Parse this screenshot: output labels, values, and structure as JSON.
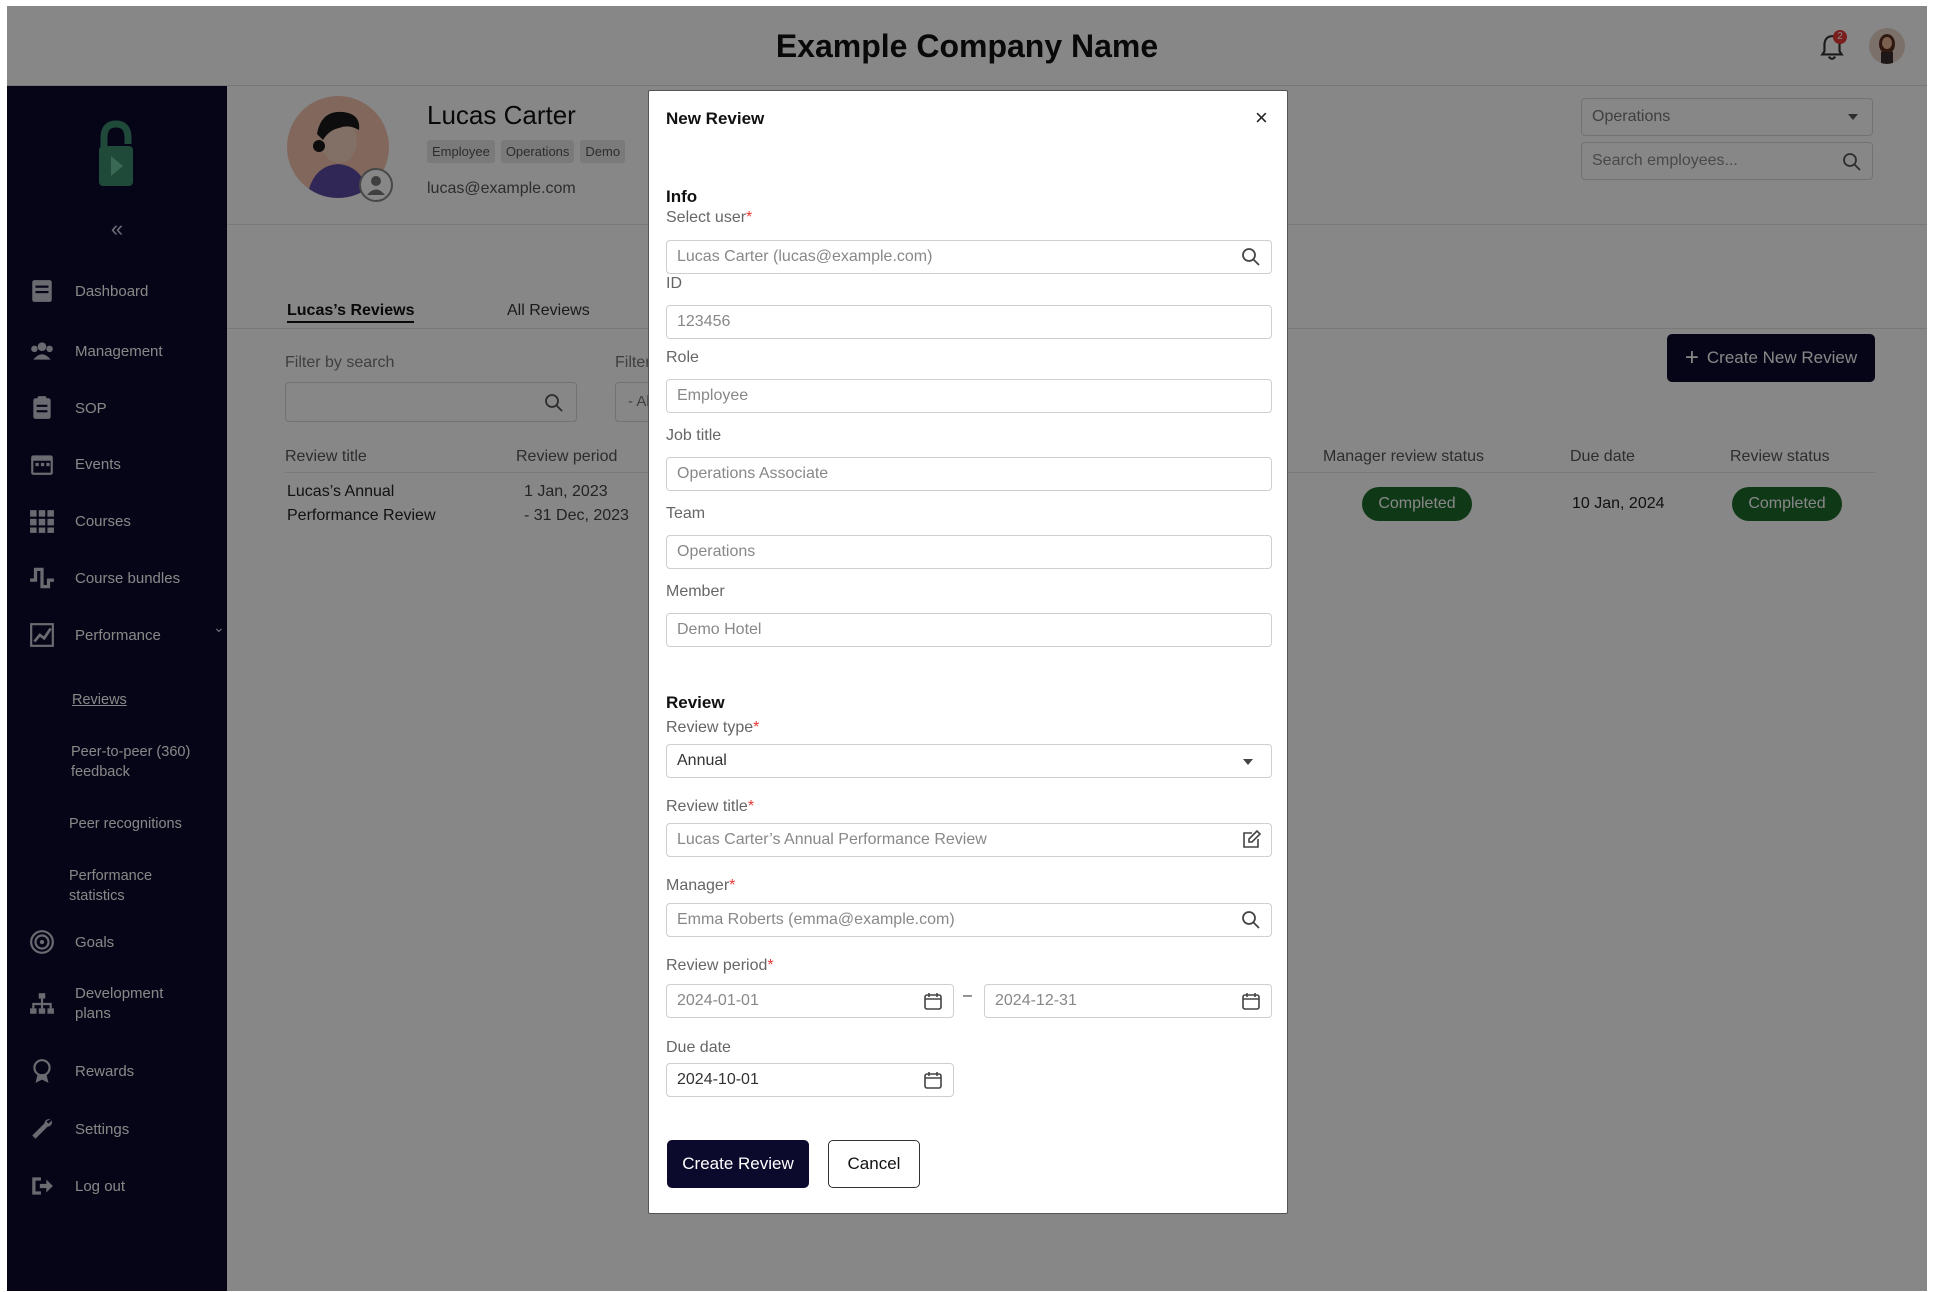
{
  "header": {
    "company_name": "Example Company Name",
    "notification_count": "2"
  },
  "sidebar": {
    "collapse_label": "«",
    "items": [
      {
        "label": "Dashboard",
        "icon": "dashboard-icon"
      },
      {
        "label": "Management",
        "icon": "people-icon"
      },
      {
        "label": "SOP",
        "icon": "clipboard-icon"
      },
      {
        "label": "Events",
        "icon": "calendar-icon"
      },
      {
        "label": "Courses",
        "icon": "grid-icon"
      },
      {
        "label": "Course bundles",
        "icon": "bundle-icon"
      },
      {
        "label": "Performance",
        "icon": "chart-icon"
      },
      {
        "label": "Goals",
        "icon": "target-icon"
      },
      {
        "label": "Development plans",
        "icon": "org-chart-icon"
      },
      {
        "label": "Rewards",
        "icon": "ribbon-icon"
      },
      {
        "label": "Settings",
        "icon": "wrench-icon"
      },
      {
        "label": "Log out",
        "icon": "logout-icon"
      }
    ],
    "performance_sub": [
      "Reviews",
      "Peer-to-peer (360) feedback",
      "Peer recognitions",
      "Performance statistics"
    ]
  },
  "profile": {
    "name": "Lucas Carter",
    "tags": [
      "Employee",
      "Operations",
      "Demo"
    ],
    "email": "lucas@example.com"
  },
  "controls": {
    "team_select": "Operations",
    "search_placeholder": "Search employees..."
  },
  "tabs": [
    "Lucas’s Reviews",
    "All Reviews"
  ],
  "create_button": "Create New Review",
  "filters": {
    "search_label": "Filter by search",
    "second_label": "Filter",
    "second_value": "- Al"
  },
  "table": {
    "headers": [
      "Review title",
      "Review period",
      "Manager review status",
      "Due date",
      "Review status"
    ],
    "rows": [
      {
        "title_line1": "Lucas’s Annual",
        "title_line2": "Performance Review",
        "period_line1": "1 Jan, 2023",
        "period_line2": "- 31 Dec, 2023",
        "manager_status": "Completed",
        "due_date": "10 Jan, 2024",
        "review_status": "Completed"
      }
    ]
  },
  "modal": {
    "title": "New Review",
    "close": "×",
    "info_section": "Info",
    "fields": {
      "select_user_label": "Select user",
      "select_user_value": "Lucas Carter (lucas@example.com)",
      "id_label": "ID",
      "id_value": "123456",
      "role_label": "Role",
      "role_value": "Employee",
      "job_title_label": "Job title",
      "job_title_value": "Operations Associate",
      "team_label": "Team",
      "team_value": "Operations",
      "member_label": "Member",
      "member_value": "Demo Hotel"
    },
    "review_section": "Review",
    "review": {
      "type_label": "Review type",
      "type_value": "Annual",
      "title_label": "Review title",
      "title_value": "Lucas Carter’s Annual Performance Review",
      "manager_label": "Manager",
      "manager_value": "Emma Roberts (emma@example.com)",
      "period_label": "Review period",
      "period_start": "2024-01-01",
      "period_sep": "–",
      "period_end": "2024-12-31",
      "due_label": "Due date",
      "due_value": "2024-10-01"
    },
    "required_mark": "*",
    "submit": "Create Review",
    "cancel": "Cancel"
  }
}
